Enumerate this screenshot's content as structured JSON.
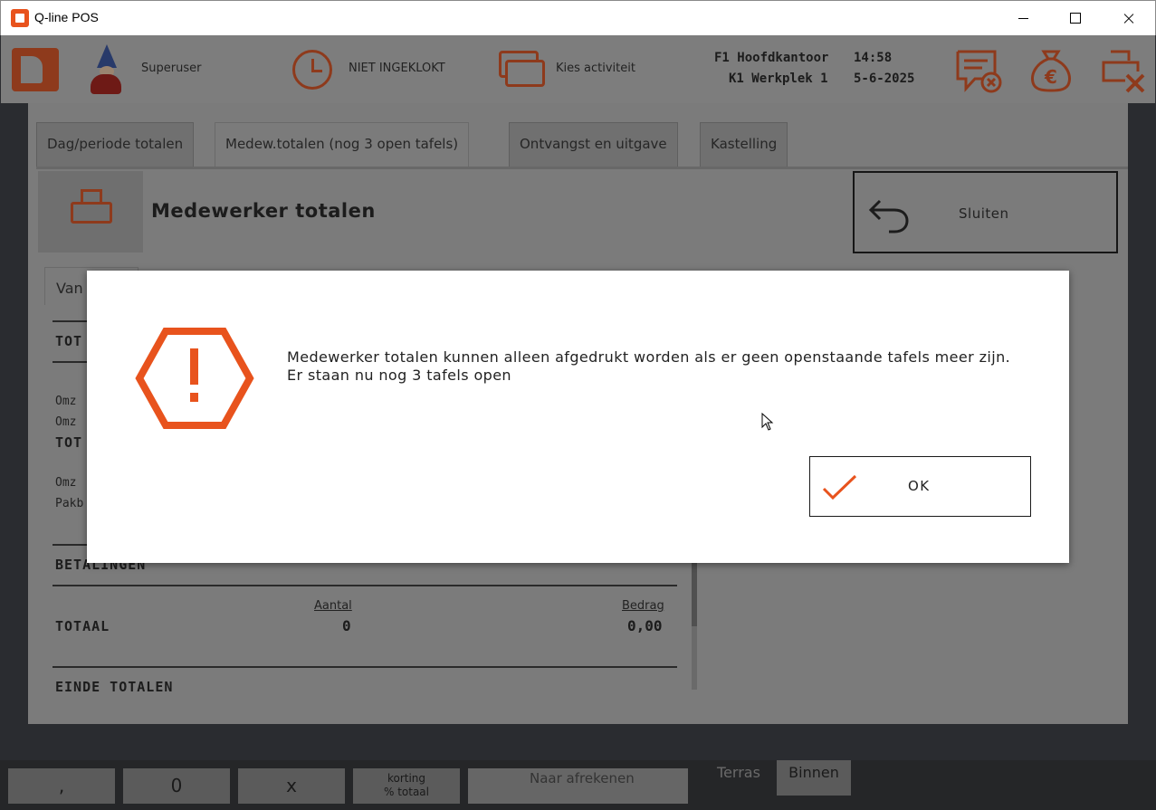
{
  "window": {
    "title": "Q-line POS"
  },
  "header": {
    "user": "Superuser",
    "clock_status": "NIET INGEKLOKT",
    "activity": "Kies activiteit",
    "location_line1": "F1 Hoofdkantoor",
    "location_line2": "K1 Werkplek 1",
    "time": "14:58",
    "date": "5-6-2025",
    "accent_color": "#e8531d"
  },
  "tabs": [
    {
      "label": "Dag/periode totalen"
    },
    {
      "label": "Medew.totalen (nog 3 open tafels)"
    },
    {
      "label": "Ontvangst en uitgave"
    },
    {
      "label": "Kastelling"
    }
  ],
  "section": {
    "title": "Medewerker totalen",
    "close_label": "Sluiten"
  },
  "report": {
    "sub_tab": "Van",
    "total_heading": "TOT",
    "row1": "Omz",
    "row2": "Omz",
    "total2": "TOT",
    "row3": "Omz",
    "row4": "Pakb",
    "payments_heading": "BETALINGEN",
    "col_count": "Aantal",
    "col_amount": "Bedrag",
    "total_label": "TOTAAL",
    "total_count": "0",
    "total_amount": "0,00",
    "end_label": "EINDE TOTALEN"
  },
  "keypad": {
    "comma": ",",
    "zero": "0",
    "x": "x",
    "discount_line1": "korting",
    "discount_line2": "% totaal",
    "pay": "Naar afrekenen",
    "terras": "Terras",
    "binnen": "Binnen"
  },
  "dialog": {
    "message_line1": "Medewerker totalen kunnen alleen afgedrukt worden als er geen openstaande tafels meer zijn.",
    "message_line2": "Er staan nu nog 3 tafels open",
    "ok_label": "OK"
  }
}
